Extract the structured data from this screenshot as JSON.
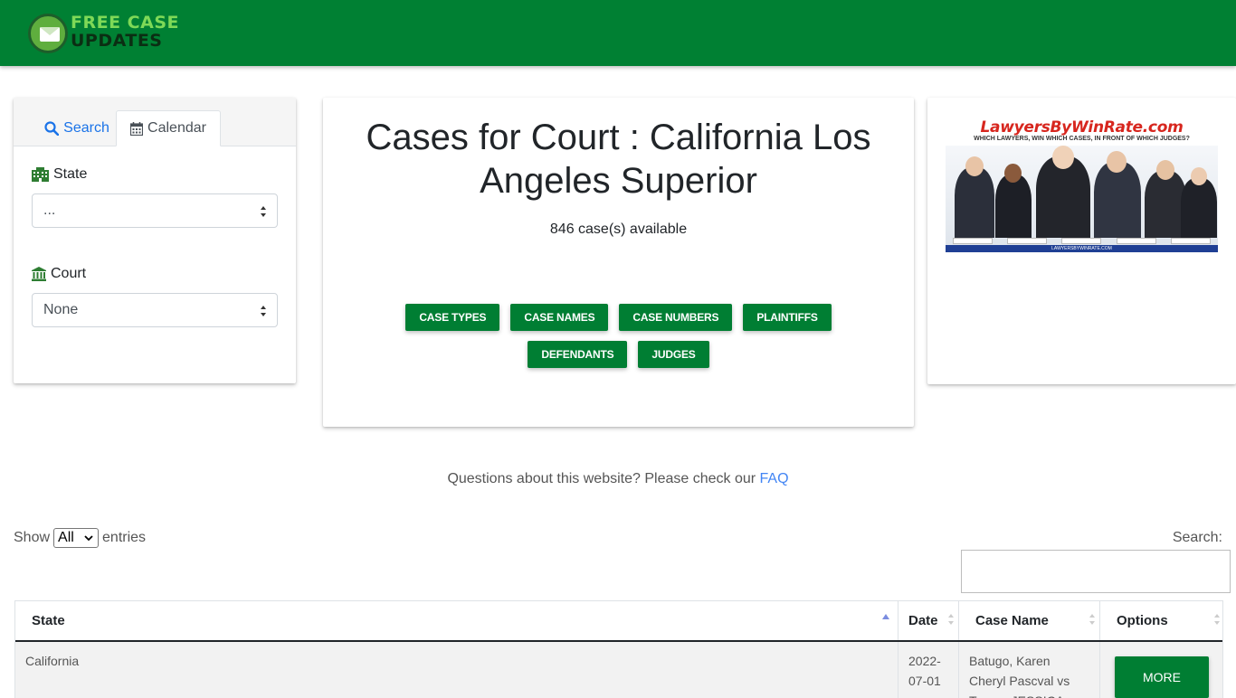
{
  "header": {
    "logo_line1": "FREE CASE",
    "logo_line2": "UPDATES",
    "bg_color": "#008033"
  },
  "sidebar": {
    "tabs": [
      {
        "label": "Search",
        "icon": "search-icon",
        "active": false
      },
      {
        "label": "Calendar",
        "icon": "calendar-icon",
        "active": true
      }
    ],
    "state_label": "State",
    "state_value": "...",
    "court_label": "Court",
    "court_value": "None"
  },
  "main": {
    "title": "Cases for Court : California Los Angeles Superior",
    "count_text": "846 case(s) available",
    "buttons_row1": [
      "CASE TYPES",
      "CASE NAMES",
      "CASE NUMBERS",
      "PLAINTIFFS"
    ],
    "buttons_row2": [
      "DEFENDANTS",
      "JUDGES"
    ]
  },
  "ad": {
    "title": "LawyersByWinRate.com",
    "subtitle": "WHICH LAWYERS, WIN WHICH CASES, IN FRONT OF WHICH JUDGES?",
    "footer": "LAWYERSBYWINRATE.COM"
  },
  "faq": {
    "text": "Questions about this website? Please check our ",
    "link": "FAQ"
  },
  "table_controls": {
    "show_label": "Show",
    "entries_value": "All",
    "entries_label": "entries",
    "search_label": "Search:"
  },
  "table": {
    "columns": [
      "State",
      "Date",
      "Case Name",
      "Options"
    ],
    "rows": [
      {
        "state": "California",
        "date": "2022-07-01",
        "case_name": "Batugo, Karen Cheryl Pascval vs Torrez, JESSICA",
        "option": "MORE"
      }
    ]
  },
  "colors": {
    "accent_green": "#007e33",
    "link_blue": "#4285f4"
  }
}
